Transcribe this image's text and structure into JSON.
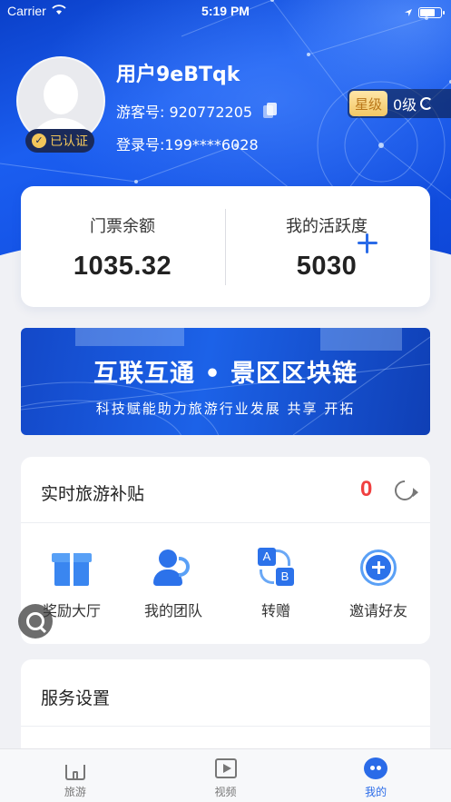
{
  "status_bar": {
    "carrier": "Carrier",
    "time": "5:19 PM"
  },
  "profile": {
    "username": "用户9eBTqk",
    "verified_label": "已认证",
    "guest_id": "游客号: 920772205",
    "login_id": "登录号:199****6028",
    "star_label": "星级",
    "level": "0级"
  },
  "balance": {
    "ticket_label": "门票余额",
    "ticket_value": "1035.32",
    "activity_label": "我的活跃度",
    "activity_value": "5030"
  },
  "banner": {
    "title": "互联互通 • 景区区块链",
    "subtitle": "科技赋能助力旅游行业发展  共享  开拓"
  },
  "subsidy": {
    "title": "实时旅游补贴",
    "count": "0",
    "actions": [
      {
        "label": "奖励大厅",
        "icon": "gift-icon"
      },
      {
        "label": "我的团队",
        "icon": "team-icon"
      },
      {
        "label": "转赠",
        "icon": "transfer-icon"
      },
      {
        "label": "邀请好友",
        "icon": "invite-icon"
      }
    ]
  },
  "service": {
    "title": "服务设置"
  },
  "tabs": [
    {
      "label": "旅游",
      "icon": "home-icon"
    },
    {
      "label": "视频",
      "icon": "video-icon"
    },
    {
      "label": "我的",
      "icon": "me-icon"
    }
  ],
  "colors": {
    "accent": "#2a6be8",
    "count_red": "#f04040",
    "star_gold": "#f2c765"
  }
}
